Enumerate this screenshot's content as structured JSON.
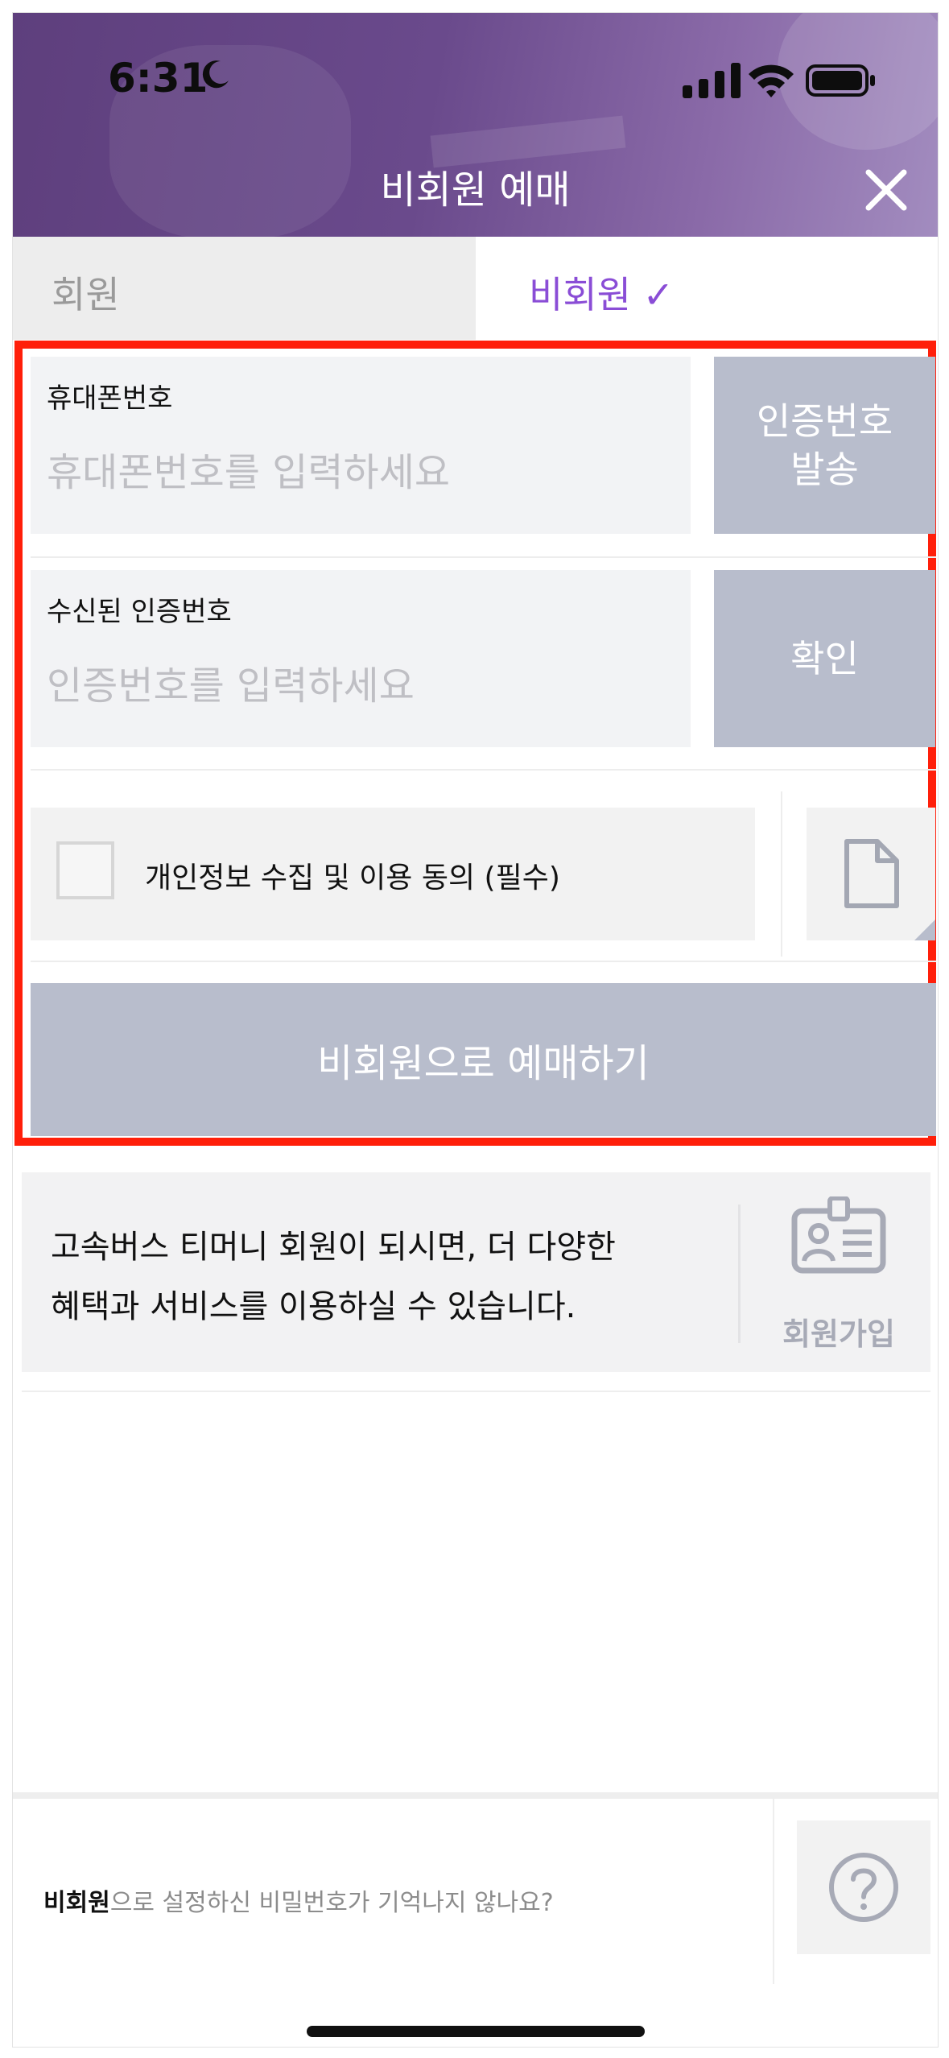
{
  "status_bar": {
    "time": "6:31"
  },
  "header": {
    "title": "비회원 예매"
  },
  "tabs": {
    "member": "회원",
    "guest": "비회원 ✓"
  },
  "form": {
    "phone": {
      "label": "휴대폰번호",
      "placeholder": "휴대폰번호를 입력하세요",
      "button_line1": "인증번호",
      "button_line2": "발송"
    },
    "code": {
      "label": "수신된 인증번호",
      "placeholder": "인증번호를 입력하세요",
      "button": "확인"
    },
    "consent": {
      "label": "개인정보 수집 및 이용 동의 (필수)",
      "checked": false
    },
    "submit": "비회원으로 예매하기"
  },
  "signup_banner": {
    "line1": "고속버스 티머니 회원이 되시면, 더 다양한",
    "line2": "혜택과 서비스를 이용하실 수 있습니다.",
    "button": "회원가입"
  },
  "footer": {
    "bold": "비회원",
    "rest": "으로 설정하신 비밀번호가 기억나지 않나요?"
  },
  "colors": {
    "header": "#6a4a8c",
    "accent": "#8a4dd6",
    "button": "#b8bdcc",
    "highlight": "#ff1f0a"
  },
  "icons": {
    "close": "close-icon",
    "document": "document-icon",
    "id_card": "id-card-icon",
    "help": "question-icon"
  }
}
